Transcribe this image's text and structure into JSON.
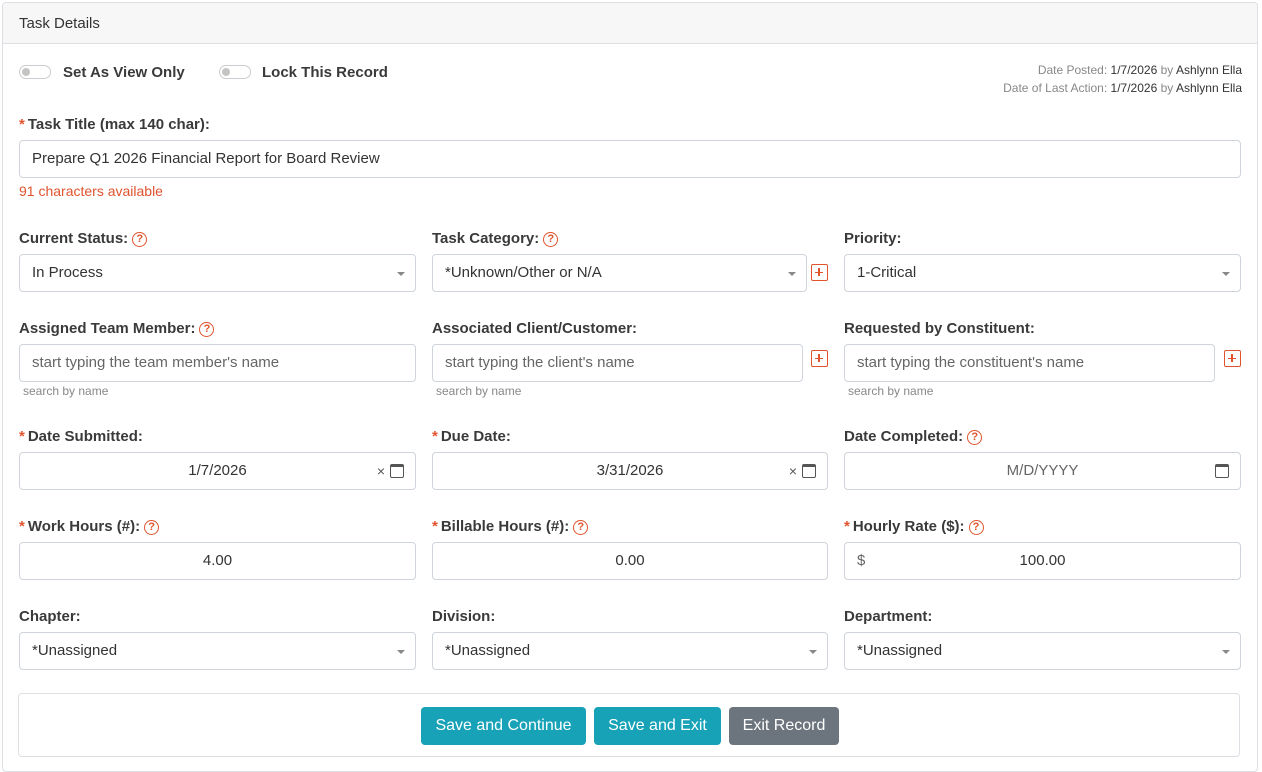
{
  "panel": {
    "title": "Task Details"
  },
  "toggles": {
    "view_only": {
      "label": "Set As View Only",
      "state": "off"
    },
    "lock_record": {
      "label": "Lock This Record",
      "state": "off"
    }
  },
  "meta": {
    "posted_prefix": "Date Posted:",
    "posted_date": "1/7/2026",
    "posted_by_word": "by",
    "posted_by": "Ashlynn Ella",
    "last_action_prefix": "Date of Last Action:",
    "last_action_date": "1/7/2026",
    "last_action_by_word": "by",
    "last_action_by": "Ashlynn Ella"
  },
  "task_title": {
    "label": "Task Title (max 140 char):",
    "value": "Prepare Q1 2026 Financial Report for Board Review",
    "available": "91 characters available"
  },
  "current_status": {
    "label": "Current Status:",
    "value": "In Process"
  },
  "task_category": {
    "label": "Task Category:",
    "value": "*Unknown/Other or N/A"
  },
  "priority": {
    "label": "Priority:",
    "value": "1-Critical"
  },
  "assigned_member": {
    "label": "Assigned Team Member:",
    "placeholder": "start typing the team member's name",
    "hint": "search by name"
  },
  "client": {
    "label": "Associated Client/Customer:",
    "placeholder": "start typing the client's name",
    "hint": "search by name"
  },
  "constituent": {
    "label": "Requested by Constituent:",
    "placeholder": "start typing the constituent's name",
    "hint": "search by name"
  },
  "date_submitted": {
    "label": "Date Submitted:",
    "value": "1/7/2026"
  },
  "due_date": {
    "label": "Due Date:",
    "value": "3/31/2026"
  },
  "date_completed": {
    "label": "Date Completed:",
    "placeholder": "M/D/YYYY"
  },
  "work_hours": {
    "label": "Work Hours (#):",
    "value": "4.00"
  },
  "billable_hours": {
    "label": "Billable Hours (#):",
    "value": "0.00"
  },
  "hourly_rate": {
    "label": "Hourly Rate ($):",
    "currency": "$",
    "value": "100.00"
  },
  "chapter": {
    "label": "Chapter:",
    "value": "*Unassigned"
  },
  "division": {
    "label": "Division:",
    "value": "*Unassigned"
  },
  "department": {
    "label": "Department:",
    "value": "*Unassigned"
  },
  "buttons": {
    "save_continue": "Save and Continue",
    "save_exit": "Save and Exit",
    "exit_record": "Exit Record"
  },
  "symbols": {
    "required": "*",
    "help": "?",
    "clear": "×"
  },
  "colors": {
    "accent": "#e0532d",
    "primary_button": "#17a2b8",
    "secondary_button": "#6c757d"
  },
  "icons": {
    "help": "question-circle-icon",
    "add": "plus-square-icon",
    "calendar": "calendar-icon",
    "clear": "close-icon",
    "dropdown": "caret-down-icon"
  }
}
